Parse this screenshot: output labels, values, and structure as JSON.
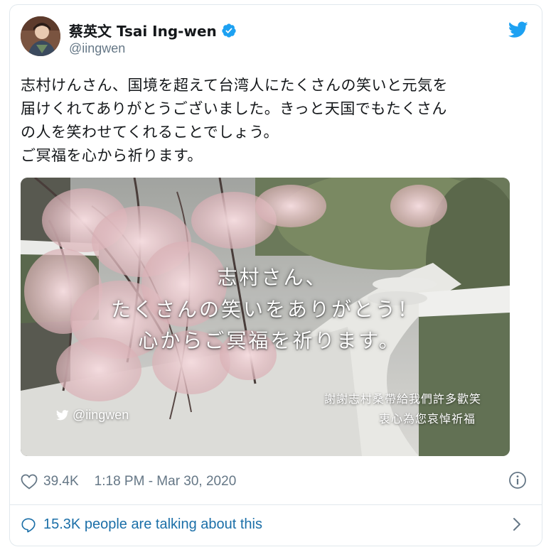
{
  "tweet": {
    "author": {
      "display_name": "蔡英文 Tsai Ing-wen",
      "handle": "@iingwen",
      "verified": true
    },
    "text_lines": [
      "志村けんさん、国境を超えて台湾人にたくさんの笑いと元気を",
      "届けくれてありがとうございました。きっと天国でもたくさん",
      "の人を笑わせてくれることでしょう。",
      "ご冥福を心から祈ります。"
    ],
    "media": {
      "overlay_lines": [
        "志村さん、",
        "たくさんの笑いをありがとう！",
        "心からご冥福を祈ります。"
      ],
      "watermark": "@iingwen",
      "chinese_lines": [
        "謝謝志村桑帶給我們許多歡笑",
        "衷心為您哀悼祈福"
      ]
    },
    "likes": "39.4K",
    "timestamp": "1:18 PM - Mar 30, 2020",
    "conversation": "15.3K people are talking about this"
  },
  "colors": {
    "twitter_blue": "#1da1f2",
    "secondary_text": "#657786",
    "link_text": "#1b6fa8",
    "border": "#e1e8ed"
  },
  "icons": [
    "avatar",
    "verified-badge-icon",
    "twitter-bird-icon",
    "heart-icon",
    "info-icon",
    "comment-bubble-icon",
    "chevron-right-icon"
  ]
}
